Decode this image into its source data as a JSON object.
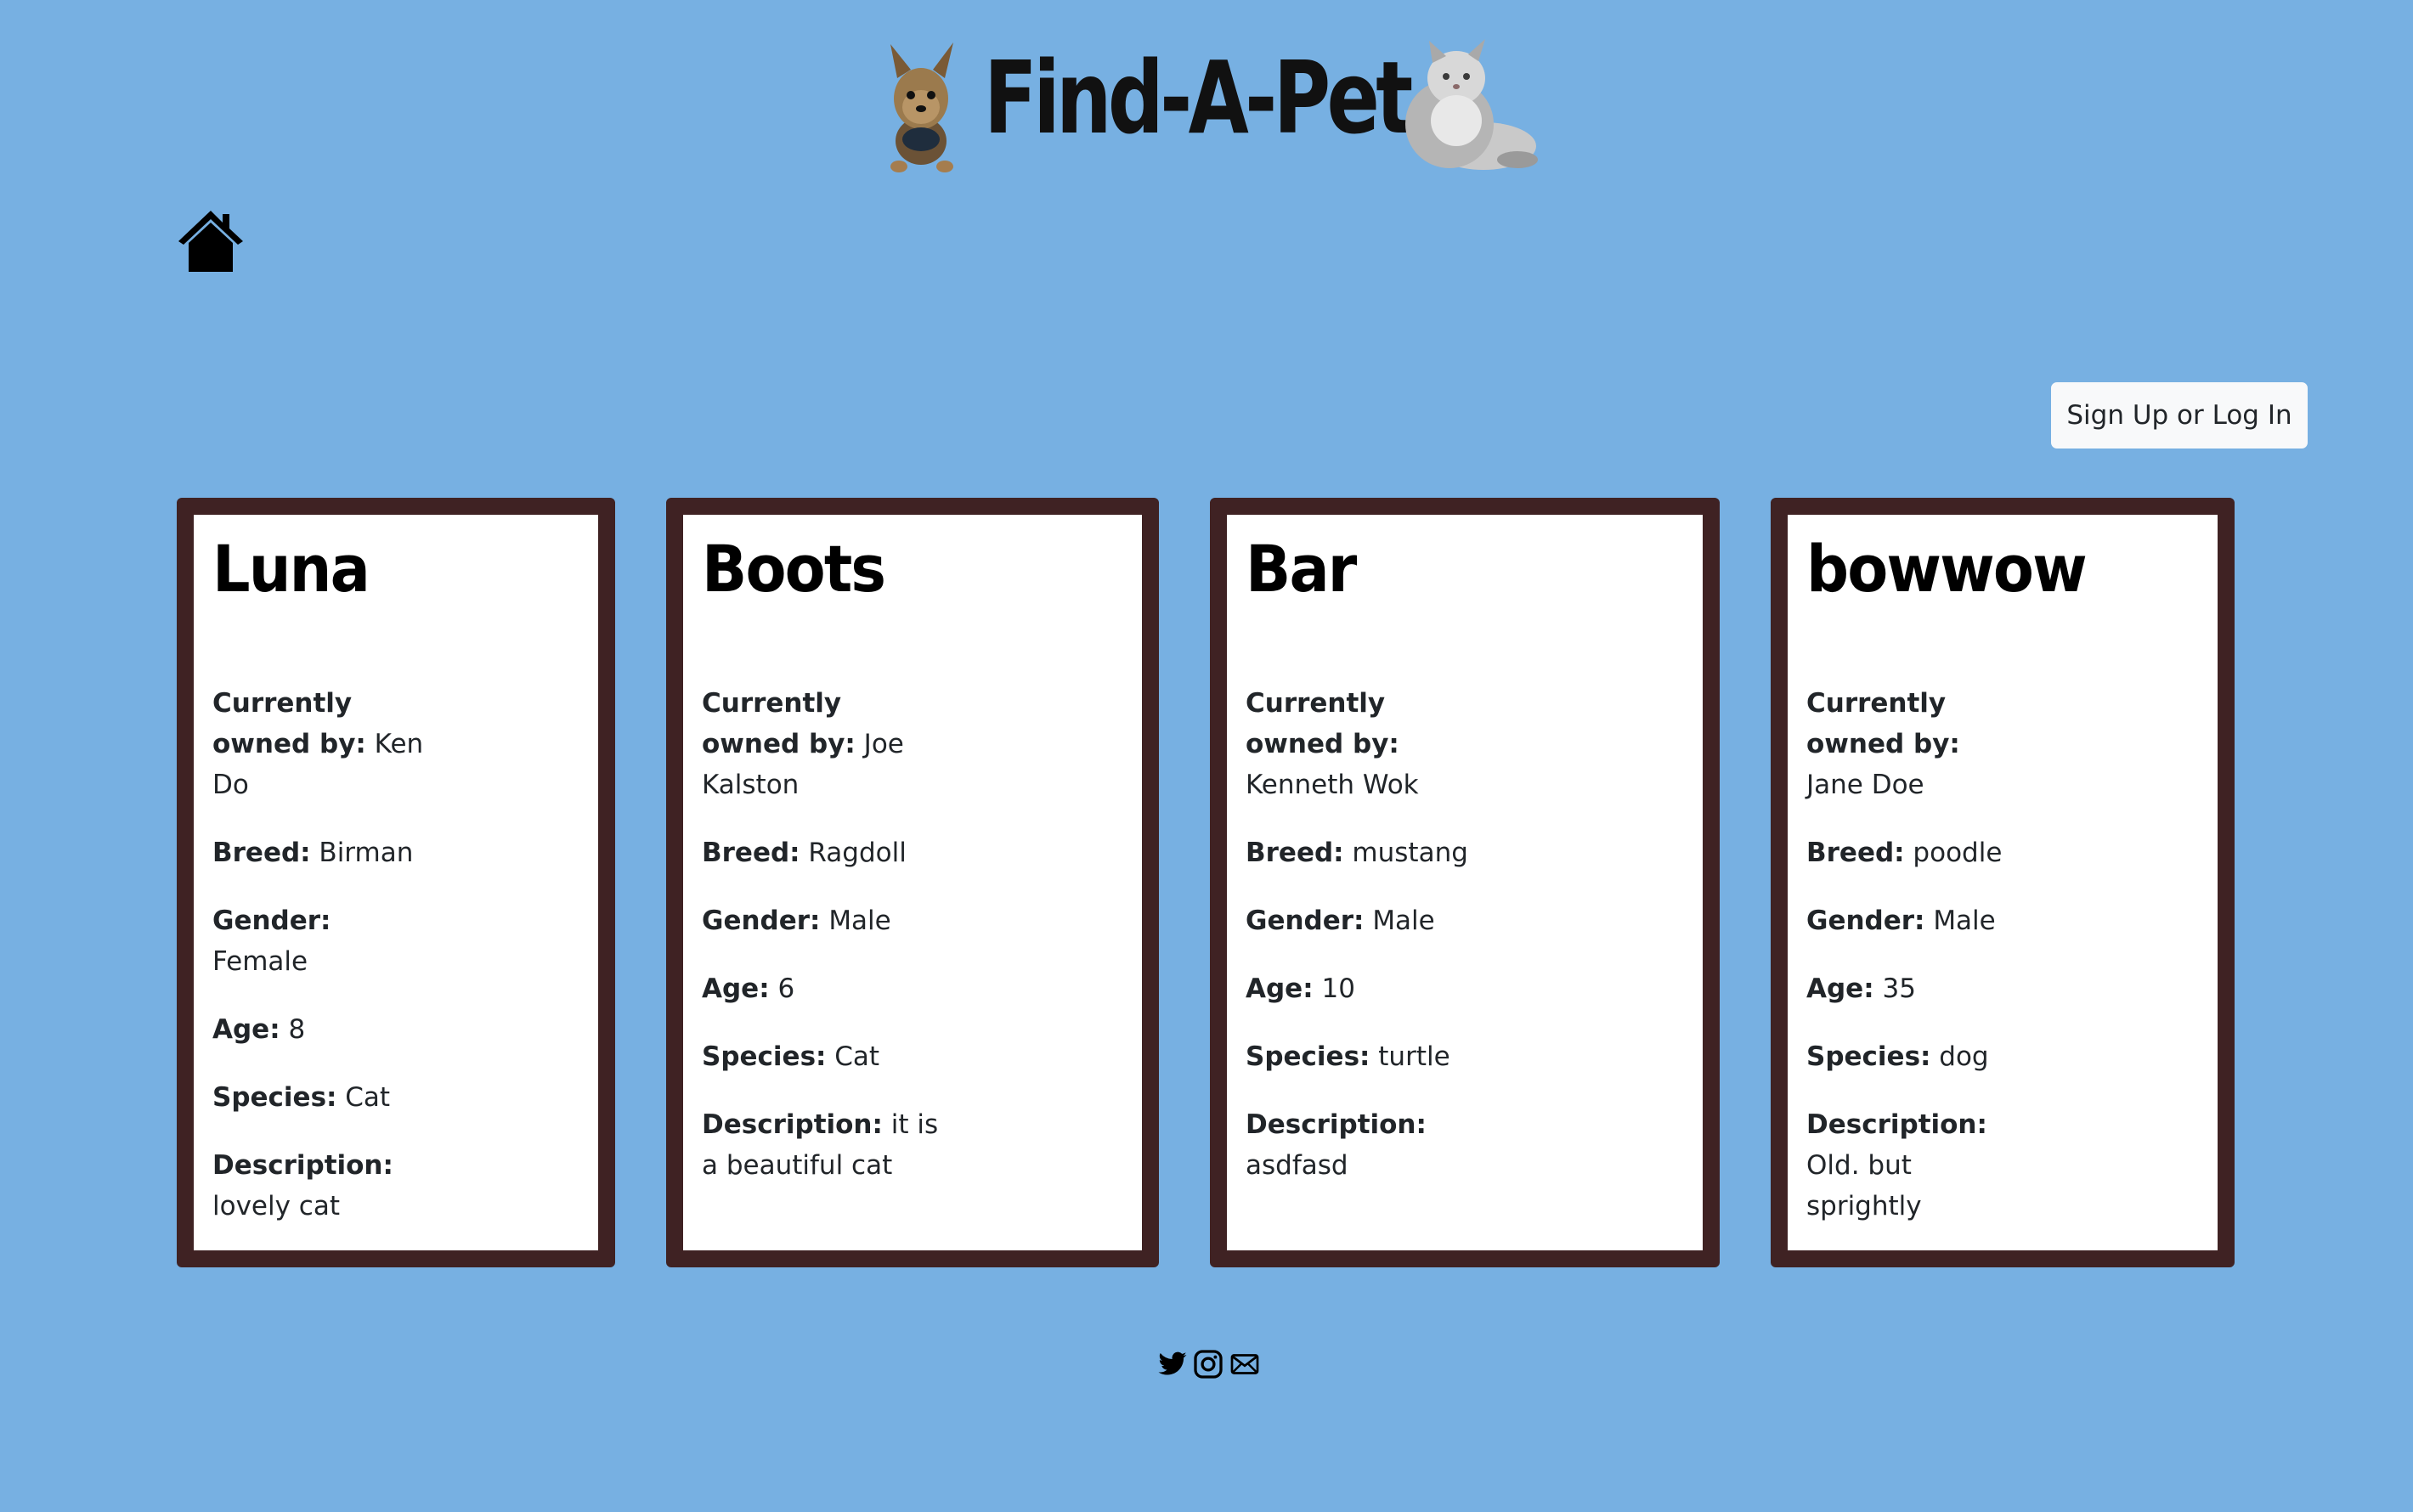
{
  "header": {
    "title": "Find-A-Pet"
  },
  "nav": {
    "home_icon": "house-icon"
  },
  "auth": {
    "signup_label": "Sign Up or Log In"
  },
  "pets": [
    {
      "name": "Luna",
      "owner_label": "Currently owned by:",
      "owner": "Ken Do",
      "breed_label": "Breed:",
      "breed": "Birman",
      "gender_label": "Gender:",
      "gender": "Female",
      "age_label": "Age:",
      "age": "8",
      "species_label": "Species:",
      "species": "Cat",
      "description_label": "Description:",
      "description": "lovely cat"
    },
    {
      "name": "Boots",
      "owner_label": "Currently owned by:",
      "owner": "Joe Kalston",
      "breed_label": "Breed:",
      "breed": "Ragdoll",
      "gender_label": "Gender:",
      "gender": "Male",
      "age_label": "Age:",
      "age": "6",
      "species_label": "Species:",
      "species": "Cat",
      "description_label": "Description:",
      "description": "it is a beautiful cat"
    },
    {
      "name": "Bar",
      "owner_label": "Currently owned by:",
      "owner": "Kenneth Wok",
      "breed_label": "Breed:",
      "breed": "mustang",
      "gender_label": "Gender:",
      "gender": "Male",
      "age_label": "Age:",
      "age": "10",
      "species_label": "Species:",
      "species": "turtle",
      "description_label": "Description:",
      "description": "asdfasd"
    },
    {
      "name": "bowwow",
      "owner_label": "Currently owned by:",
      "owner": "Jane Doe",
      "breed_label": "Breed:",
      "breed": "poodle",
      "gender_label": "Gender:",
      "gender": "Male",
      "age_label": "Age:",
      "age": "35",
      "species_label": "Species:",
      "species": "dog",
      "description_label": "Description:",
      "description": "Old. but sprightly"
    }
  ],
  "footer": {
    "icons": [
      "twitter-icon",
      "instagram-icon",
      "email-icon"
    ]
  },
  "colors": {
    "background": "#77b0e2",
    "card_border": "#3f2223",
    "card_background": "#ffffff",
    "button_background": "#f8f9fa"
  }
}
